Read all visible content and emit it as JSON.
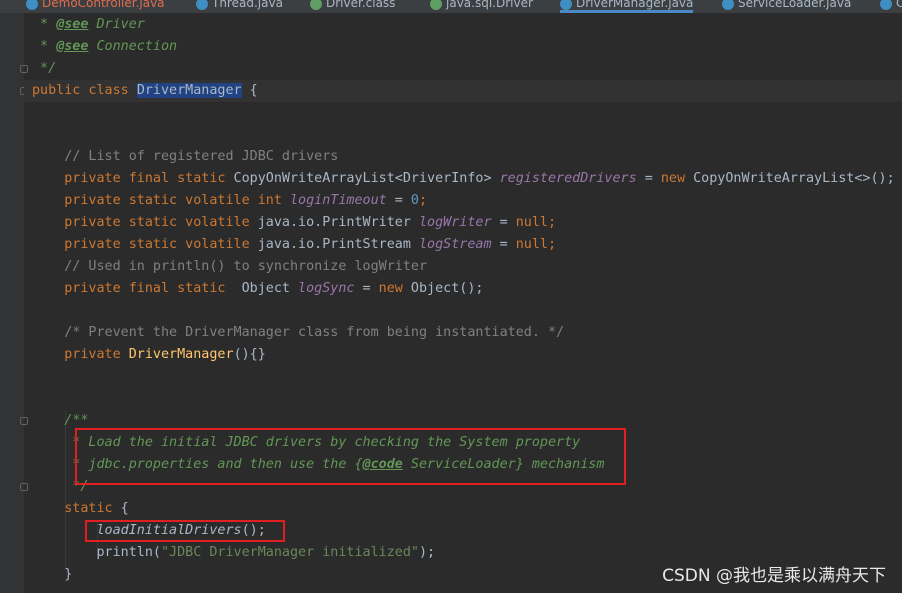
{
  "tabs": [
    {
      "label": "DemoController.java",
      "color": "#e06c4f",
      "icon": "java-class-icon"
    },
    {
      "label": "Thread.java",
      "color": "#a9b7c6",
      "icon": "java-class-icon"
    },
    {
      "label": "Driver.class",
      "color": "#a9b7c6",
      "icon": "interface-icon"
    },
    {
      "label": "java.sql.Driver",
      "color": "#a9b7c6",
      "icon": "interface-icon"
    },
    {
      "label": "DriverManager.java",
      "color": "#a9b7c6",
      "icon": "java-class-icon",
      "active": true
    },
    {
      "label": "ServiceLoader.java",
      "color": "#a9b7c6",
      "icon": "java-class-icon"
    },
    {
      "label": "C",
      "color": "#a9b7c6",
      "icon": "java-class-icon"
    }
  ],
  "code": {
    "l1": {
      "star": " * ",
      "tag": "@see",
      "rest": " Driver"
    },
    "l2": {
      "star": " * ",
      "tag": "@see",
      "rest": " Connection"
    },
    "l3": {
      "text": " */"
    },
    "l4": {
      "kw": "public class ",
      "name": "DriverManager",
      "rest": " {"
    },
    "l5": {
      "text": "    // List of registered JDBC drivers"
    },
    "l6": {
      "kw": "    private final static ",
      "type": "CopyOnWriteArrayList<DriverInfo> ",
      "field": "registeredDrivers",
      "eq": " = ",
      "kw2": "new ",
      "rest": "CopyOnWriteArrayList<>();"
    },
    "l7": {
      "kw": "    private static volatile int ",
      "field": "loginTimeout",
      "eq": " = ",
      "num": "0",
      "rest": ";"
    },
    "l8": {
      "kw": "    private static volatile ",
      "type": "java.io.PrintWriter ",
      "field": "logWriter",
      "eq": " = ",
      "kw2": "null",
      "rest": ";"
    },
    "l9": {
      "kw": "    private static volatile ",
      "type": "java.io.PrintStream ",
      "field": "logStream",
      "eq": " = ",
      "kw2": "null",
      "rest": ";"
    },
    "l10": {
      "text": "    // Used in println() to synchronize logWriter"
    },
    "l11": {
      "kw": "    private final static  ",
      "type": "Object ",
      "field": "logSync",
      "eq": " = ",
      "kw2": "new ",
      "rest": "Object();"
    },
    "l12": {
      "text": "    /* Prevent the DriverManager class from being instantiated. */"
    },
    "l13": {
      "kw": "    private ",
      "name": "DriverManager",
      "rest": "(){}"
    },
    "l14": {
      "text": "    /**"
    },
    "l15": {
      "text": "     * Load the initial JDBC drivers by checking the System property"
    },
    "l16": {
      "pre": "     * jdbc.properties and then use the {",
      "tag": "@code",
      "post": " ServiceLoader} mechanism"
    },
    "l17": {
      "text": "     */"
    },
    "l18": {
      "kw": "    static",
      "rest": " {"
    },
    "l19": {
      "pre": "        ",
      "call": "loadInitialDrivers",
      "rest": "();"
    },
    "l20": {
      "pre": "        println(",
      "str": "\"JDBC DriverManager initialized\"",
      "rest": ");"
    },
    "l21": {
      "text": "    }"
    }
  },
  "watermark": "CSDN @我也是乘以满舟天下",
  "colors": {
    "highlight_box": "#e02020",
    "background": "#2b2b2b"
  }
}
